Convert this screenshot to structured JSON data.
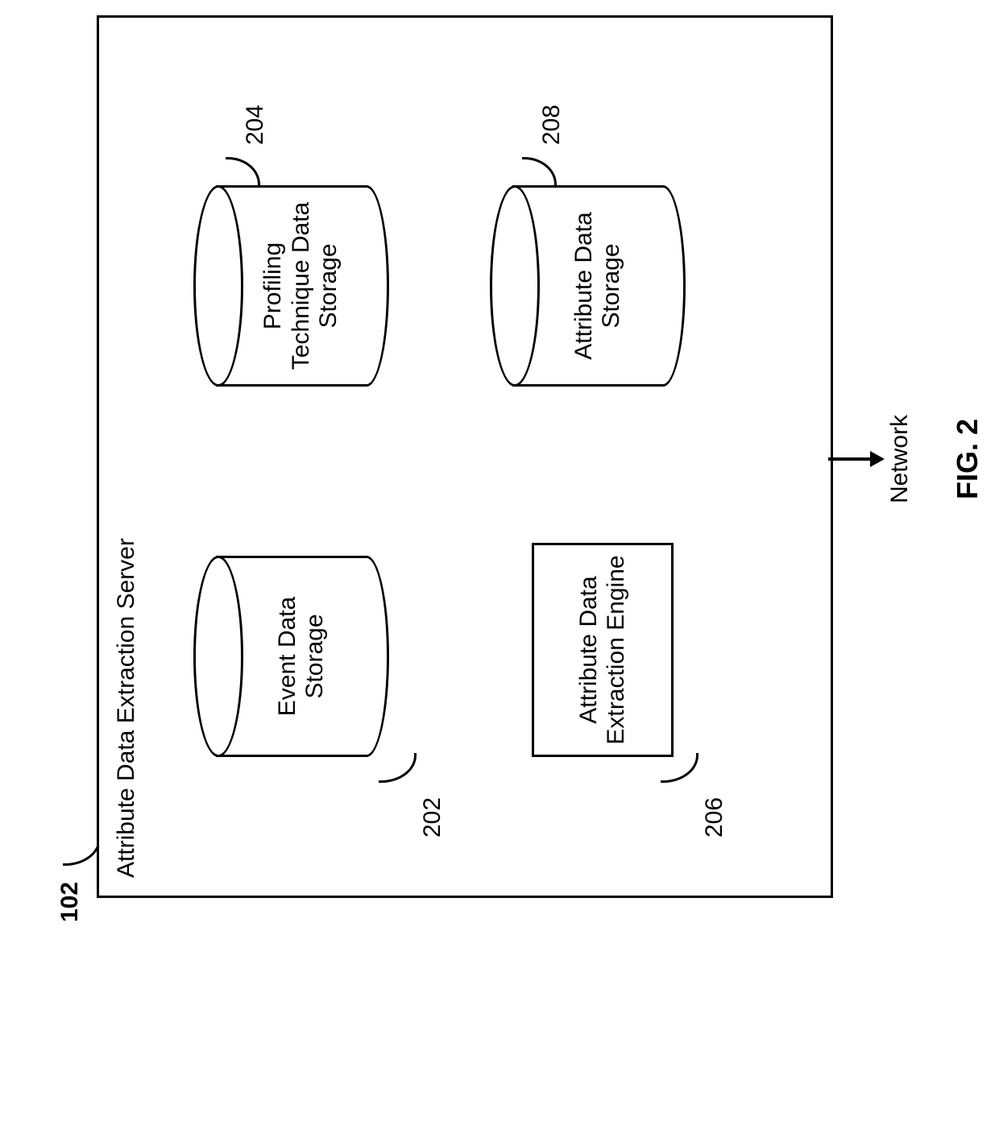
{
  "figure": {
    "caption": "FIG. 2",
    "server_ref": "102",
    "server_title": "Attribute Data Extraction Server",
    "network_label": "Network",
    "blocks": {
      "event_storage": {
        "ref": "202",
        "label_l1": "Event Data",
        "label_l2": "Storage"
      },
      "profiling_storage": {
        "ref": "204",
        "label_l1": "Profiling",
        "label_l2": "Technique Data",
        "label_l3": "Storage"
      },
      "extraction_engine": {
        "ref": "206",
        "label_l1": "Attribute Data",
        "label_l2": "Extraction Engine"
      },
      "attribute_storage": {
        "ref": "208",
        "label_l1": "Attribute Data",
        "label_l2": "Storage"
      }
    }
  }
}
